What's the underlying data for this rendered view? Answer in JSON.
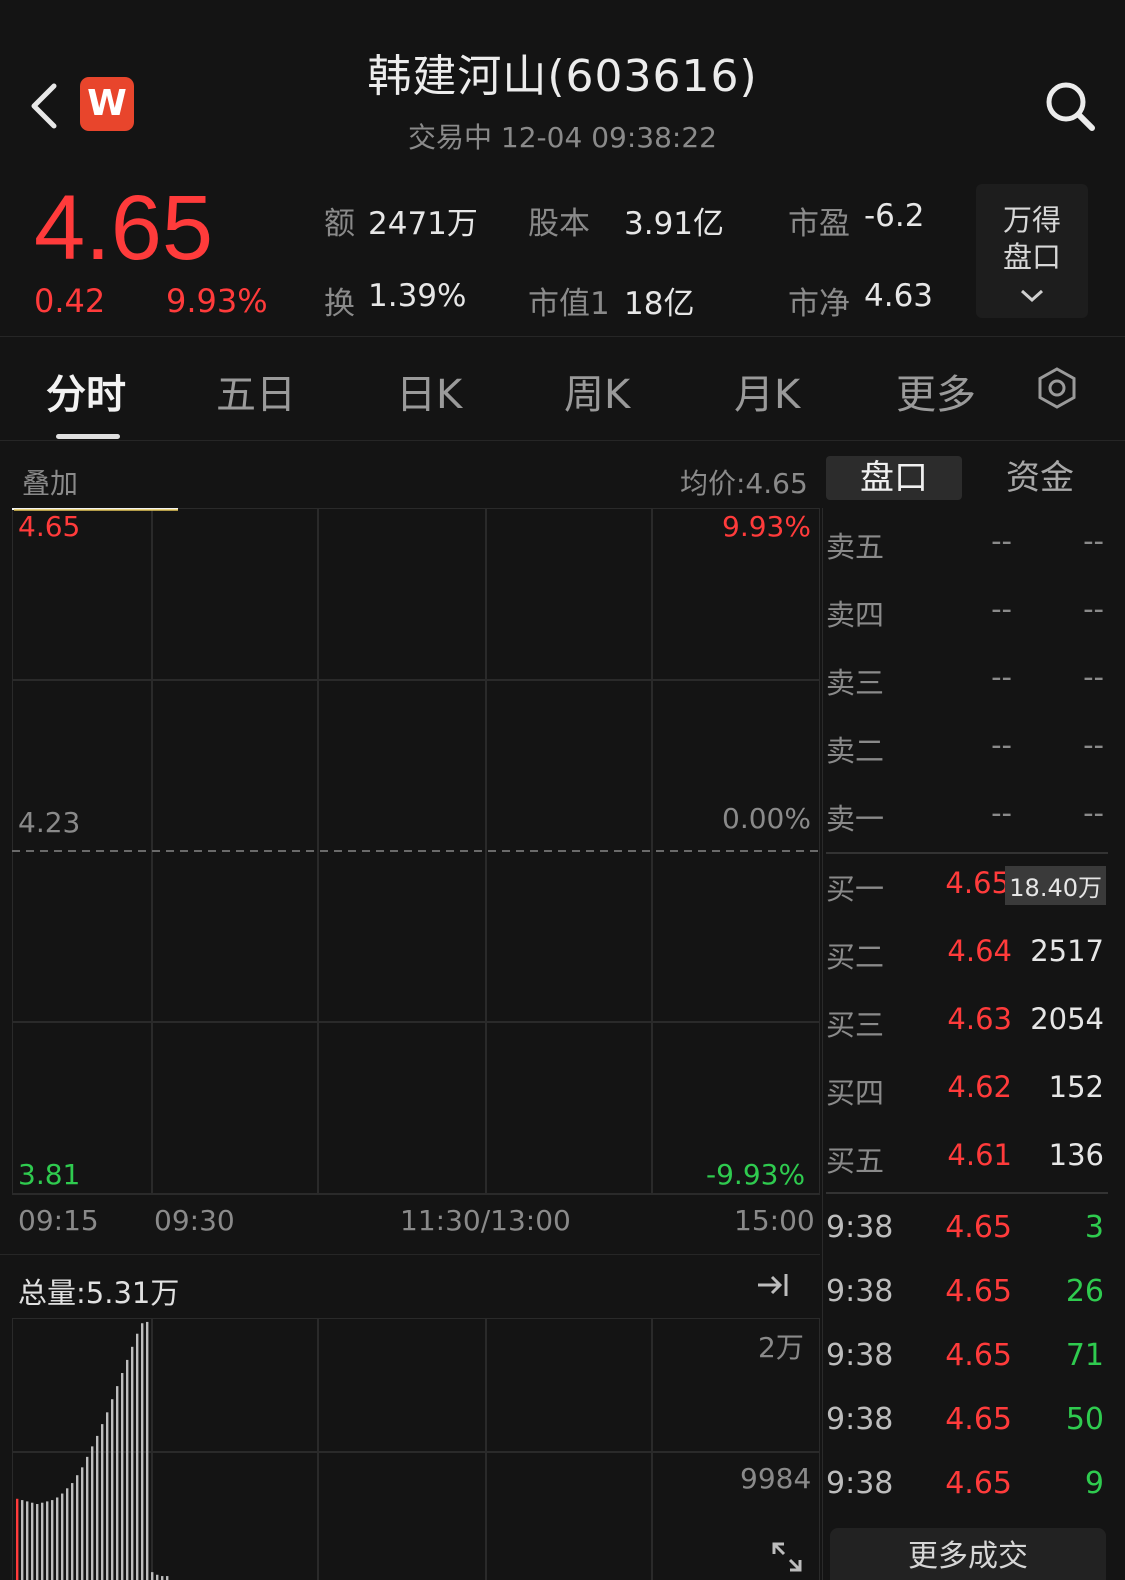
{
  "header": {
    "title": "韩建河山(603616)",
    "subtitle": "交易中  12-04 09:38:22",
    "logo_text": "W",
    "icons": [
      "back-icon",
      "search-icon"
    ]
  },
  "quote": {
    "price": "4.65",
    "change": "0.42",
    "change_pct": "9.93%",
    "stats": [
      {
        "label": "额",
        "value": "2471万"
      },
      {
        "label": "股本",
        "value": "3.91亿"
      },
      {
        "label": "市盈",
        "value": "-6.2"
      },
      {
        "label": "换",
        "value": "1.39%"
      },
      {
        "label": "市值1",
        "value": "18亿"
      },
      {
        "label": "市净",
        "value": "4.63"
      }
    ],
    "wind_button": [
      "万得",
      "盘口"
    ]
  },
  "tabs": [
    "分时",
    "五日",
    "日K",
    "周K",
    "月K",
    "更多"
  ],
  "chart": {
    "overlay_label": "叠加",
    "avg_price": "均价:4.65",
    "price_top": "4.65",
    "price_mid": "4.23",
    "price_bottom": "3.81",
    "pct_top": "9.93%",
    "pct_mid": "0.00%",
    "pct_bottom": "-9.93%",
    "times": [
      "09:15",
      "09:30",
      "11:30/13:00",
      "15:00"
    ],
    "volume_label": "总量:5.31万",
    "vol_top": "2万",
    "vol_mid": "9984"
  },
  "chart_data": {
    "type": "bar",
    "title": "",
    "ylabel": "",
    "ylim": [
      0,
      20000
    ],
    "values": [
      6200,
      6100,
      6000,
      5900,
      5800,
      5900,
      6000,
      6100,
      6300,
      6600,
      7000,
      7400,
      8000,
      8600,
      9400,
      10200,
      11000,
      11900,
      12800,
      13800,
      14800,
      15800,
      16800,
      17800,
      18800,
      19600,
      19700,
      600,
      400,
      300,
      300
    ]
  },
  "order_book": {
    "tabs": [
      "盘口",
      "资金"
    ],
    "asks": [
      {
        "name": "卖五",
        "price": "--",
        "vol": "--"
      },
      {
        "name": "卖四",
        "price": "--",
        "vol": "--"
      },
      {
        "name": "卖三",
        "price": "--",
        "vol": "--"
      },
      {
        "name": "卖二",
        "price": "--",
        "vol": "--"
      },
      {
        "name": "卖一",
        "price": "--",
        "vol": "--"
      }
    ],
    "bids": [
      {
        "name": "买一",
        "price": "4.65",
        "vol": "18.40万"
      },
      {
        "name": "买二",
        "price": "4.64",
        "vol": "2517"
      },
      {
        "name": "买三",
        "price": "4.63",
        "vol": "2054"
      },
      {
        "name": "买四",
        "price": "4.62",
        "vol": "152"
      },
      {
        "name": "买五",
        "price": "4.61",
        "vol": "136"
      }
    ],
    "trades": [
      {
        "time": "9:38",
        "price": "4.65",
        "vol": "3"
      },
      {
        "time": "9:38",
        "price": "4.65",
        "vol": "26"
      },
      {
        "time": "9:38",
        "price": "4.65",
        "vol": "71"
      },
      {
        "time": "9:38",
        "price": "4.65",
        "vol": "50"
      },
      {
        "time": "9:38",
        "price": "4.65",
        "vol": "9"
      }
    ],
    "more_button": "更多成交"
  },
  "colors": {
    "up": "#ff3b3b",
    "down": "#2fcb4f",
    "bg": "#141414"
  }
}
